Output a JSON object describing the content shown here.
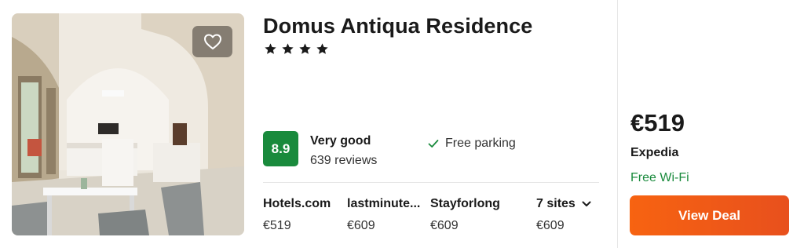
{
  "hotel": {
    "name": "Domus Antiqua Residence",
    "star_count": 4,
    "score": "8.9",
    "rating_label": "Very good",
    "review_count": "639 reviews",
    "amenity": "Free parking"
  },
  "offers": [
    {
      "site": "Hotels.com",
      "price": "€519"
    },
    {
      "site": "lastminute...",
      "price": "€609"
    },
    {
      "site": "Stayforlong",
      "price": "€609"
    }
  ],
  "more_sites": {
    "label": "7 sites",
    "price": "€609"
  },
  "best_deal": {
    "price": "€519",
    "provider": "Expedia",
    "perk": "Free Wi-Fi",
    "button_label": "View Deal"
  },
  "icons": {
    "favorite": "heart-icon",
    "star": "star-icon",
    "check": "check-icon",
    "chevron": "chevron-down-icon"
  },
  "colors": {
    "score_green": "#198a3c",
    "cta_orange": "#f76311",
    "perk_green": "#198a3c"
  }
}
